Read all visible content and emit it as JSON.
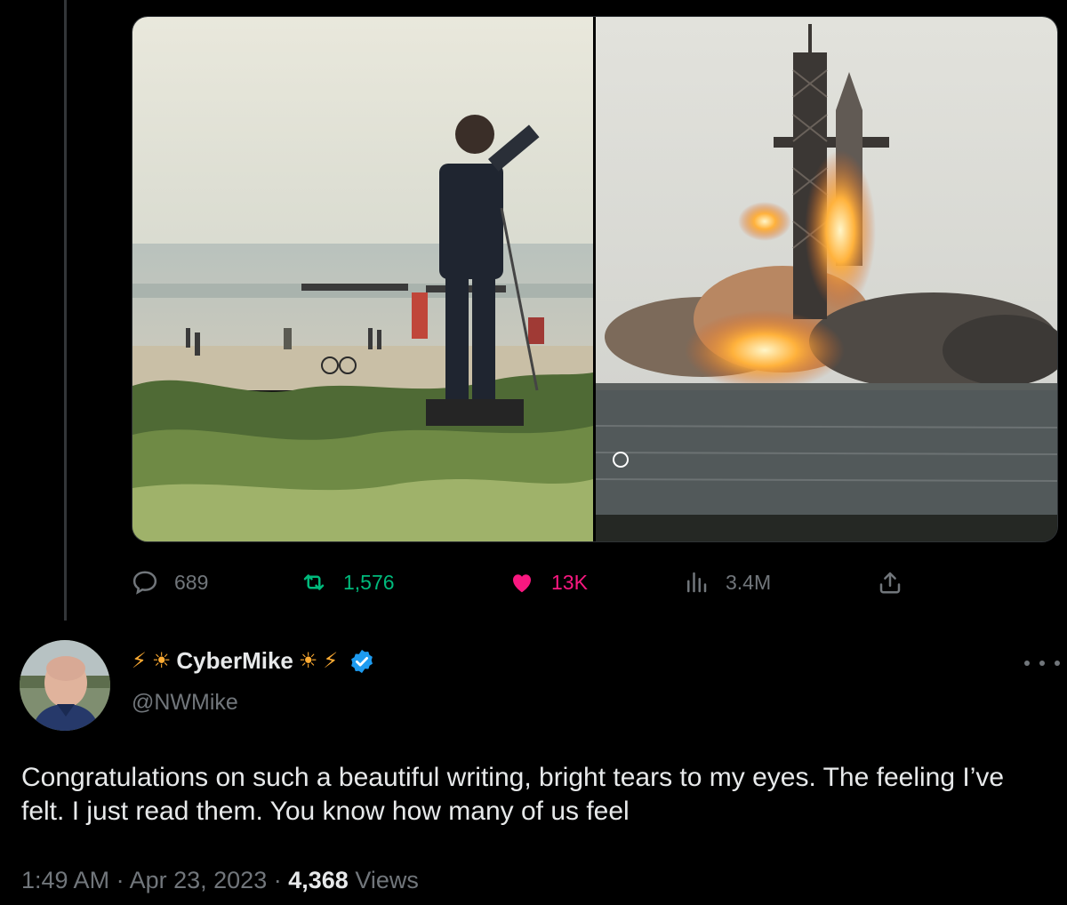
{
  "media": {
    "left_image": "Man photographing from beach dunes with crowd on shore",
    "right_image": "Rocket launching from tower with large smoke plume over water"
  },
  "actions": {
    "replies": "689",
    "retweets": "1,576",
    "likes": "13K",
    "views": "3.4M",
    "colors": {
      "retweet": "#00ba7c",
      "like": "#f91880",
      "muted": "#71767b"
    }
  },
  "reply": {
    "display_name": "CyberMike",
    "emoji_bolt": "⚡",
    "emoji_sun": "☀",
    "handle": "@NWMike",
    "verified_color": "#1d9bf0",
    "text": "Congratulations on such a beautiful writing, bright tears to my eyes. The feeling I’ve felt. I just read them. You know how many of us feel",
    "time": "1:49 AM",
    "separator": "·",
    "date": "Apr 23, 2023",
    "view_count": "4,368",
    "views_label": "Views"
  }
}
